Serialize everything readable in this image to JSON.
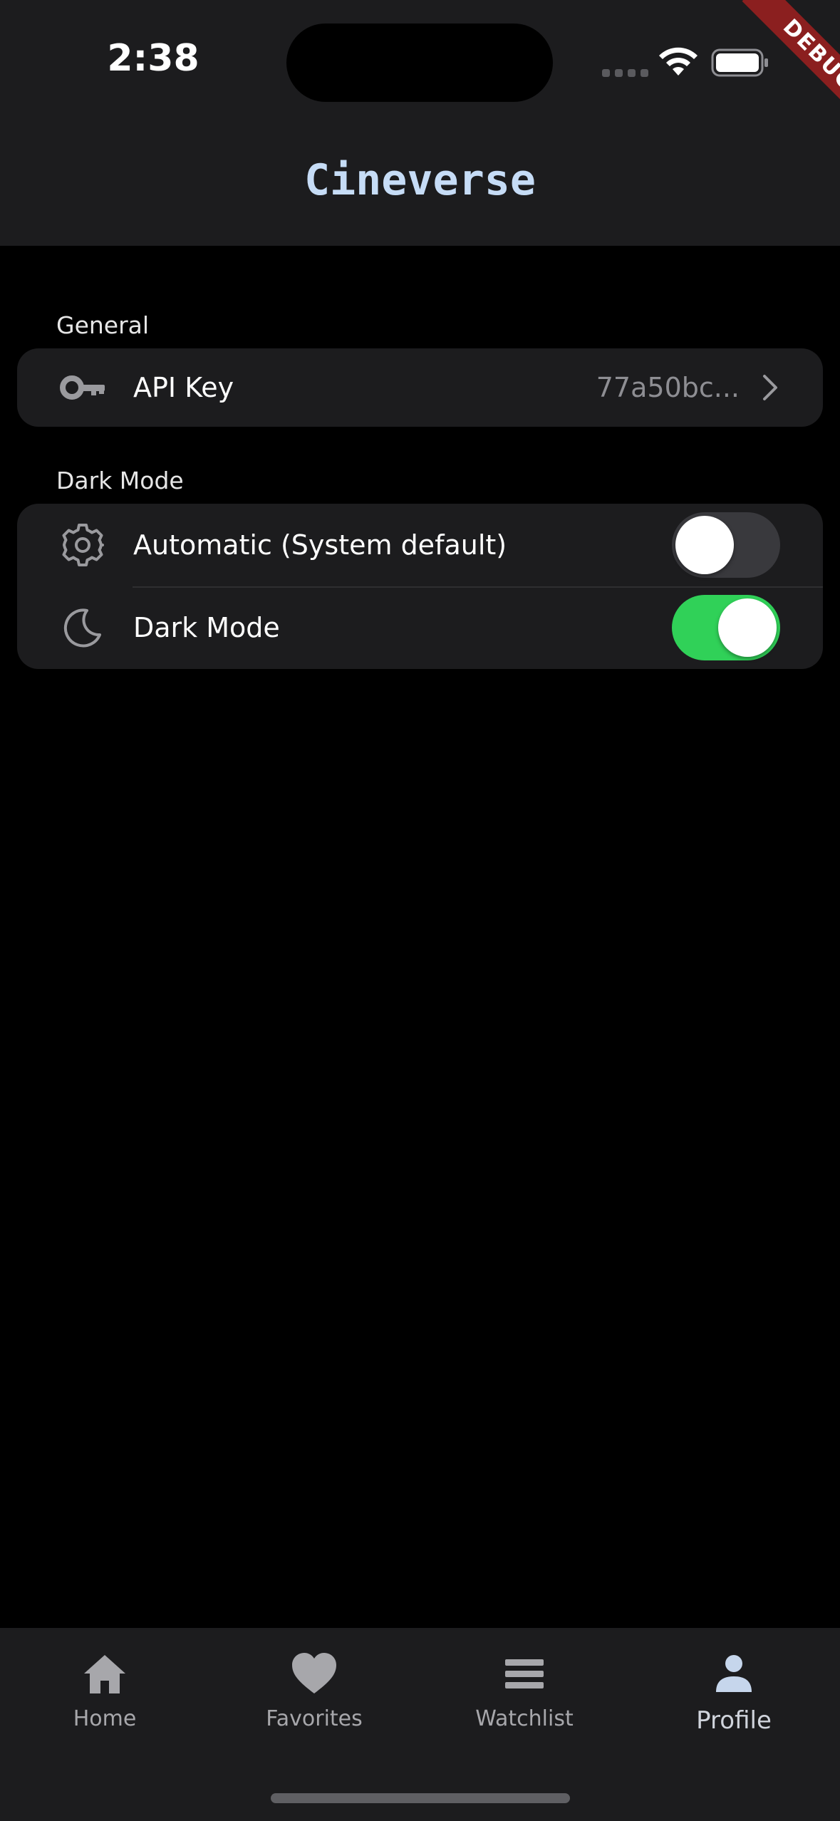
{
  "status_bar": {
    "time": "2:38"
  },
  "debug_banner": "DEBUG",
  "app_bar": {
    "title": "Cineverse"
  },
  "sections": {
    "general": {
      "label": "General",
      "api_key": {
        "label": "API Key",
        "value": "77a50bc...",
        "icon": "key-icon"
      }
    },
    "dark_mode": {
      "label": "Dark Mode",
      "automatic": {
        "label": "Automatic (System default)",
        "enabled": false,
        "icon": "gear-icon"
      },
      "dark_mode": {
        "label": "Dark Mode",
        "enabled": true,
        "icon": "moon-icon"
      }
    }
  },
  "bottom_nav": {
    "items": [
      {
        "label": "Home",
        "icon": "home-icon"
      },
      {
        "label": "Favorites",
        "icon": "heart-icon"
      },
      {
        "label": "Watchlist",
        "icon": "list-icon"
      },
      {
        "label": "Profile",
        "icon": "person-icon"
      }
    ],
    "active": "Profile"
  },
  "colors": {
    "switch_on": "#30d158",
    "title": "#c6dcf6",
    "surface": "#1c1c1e",
    "background": "#000000"
  }
}
